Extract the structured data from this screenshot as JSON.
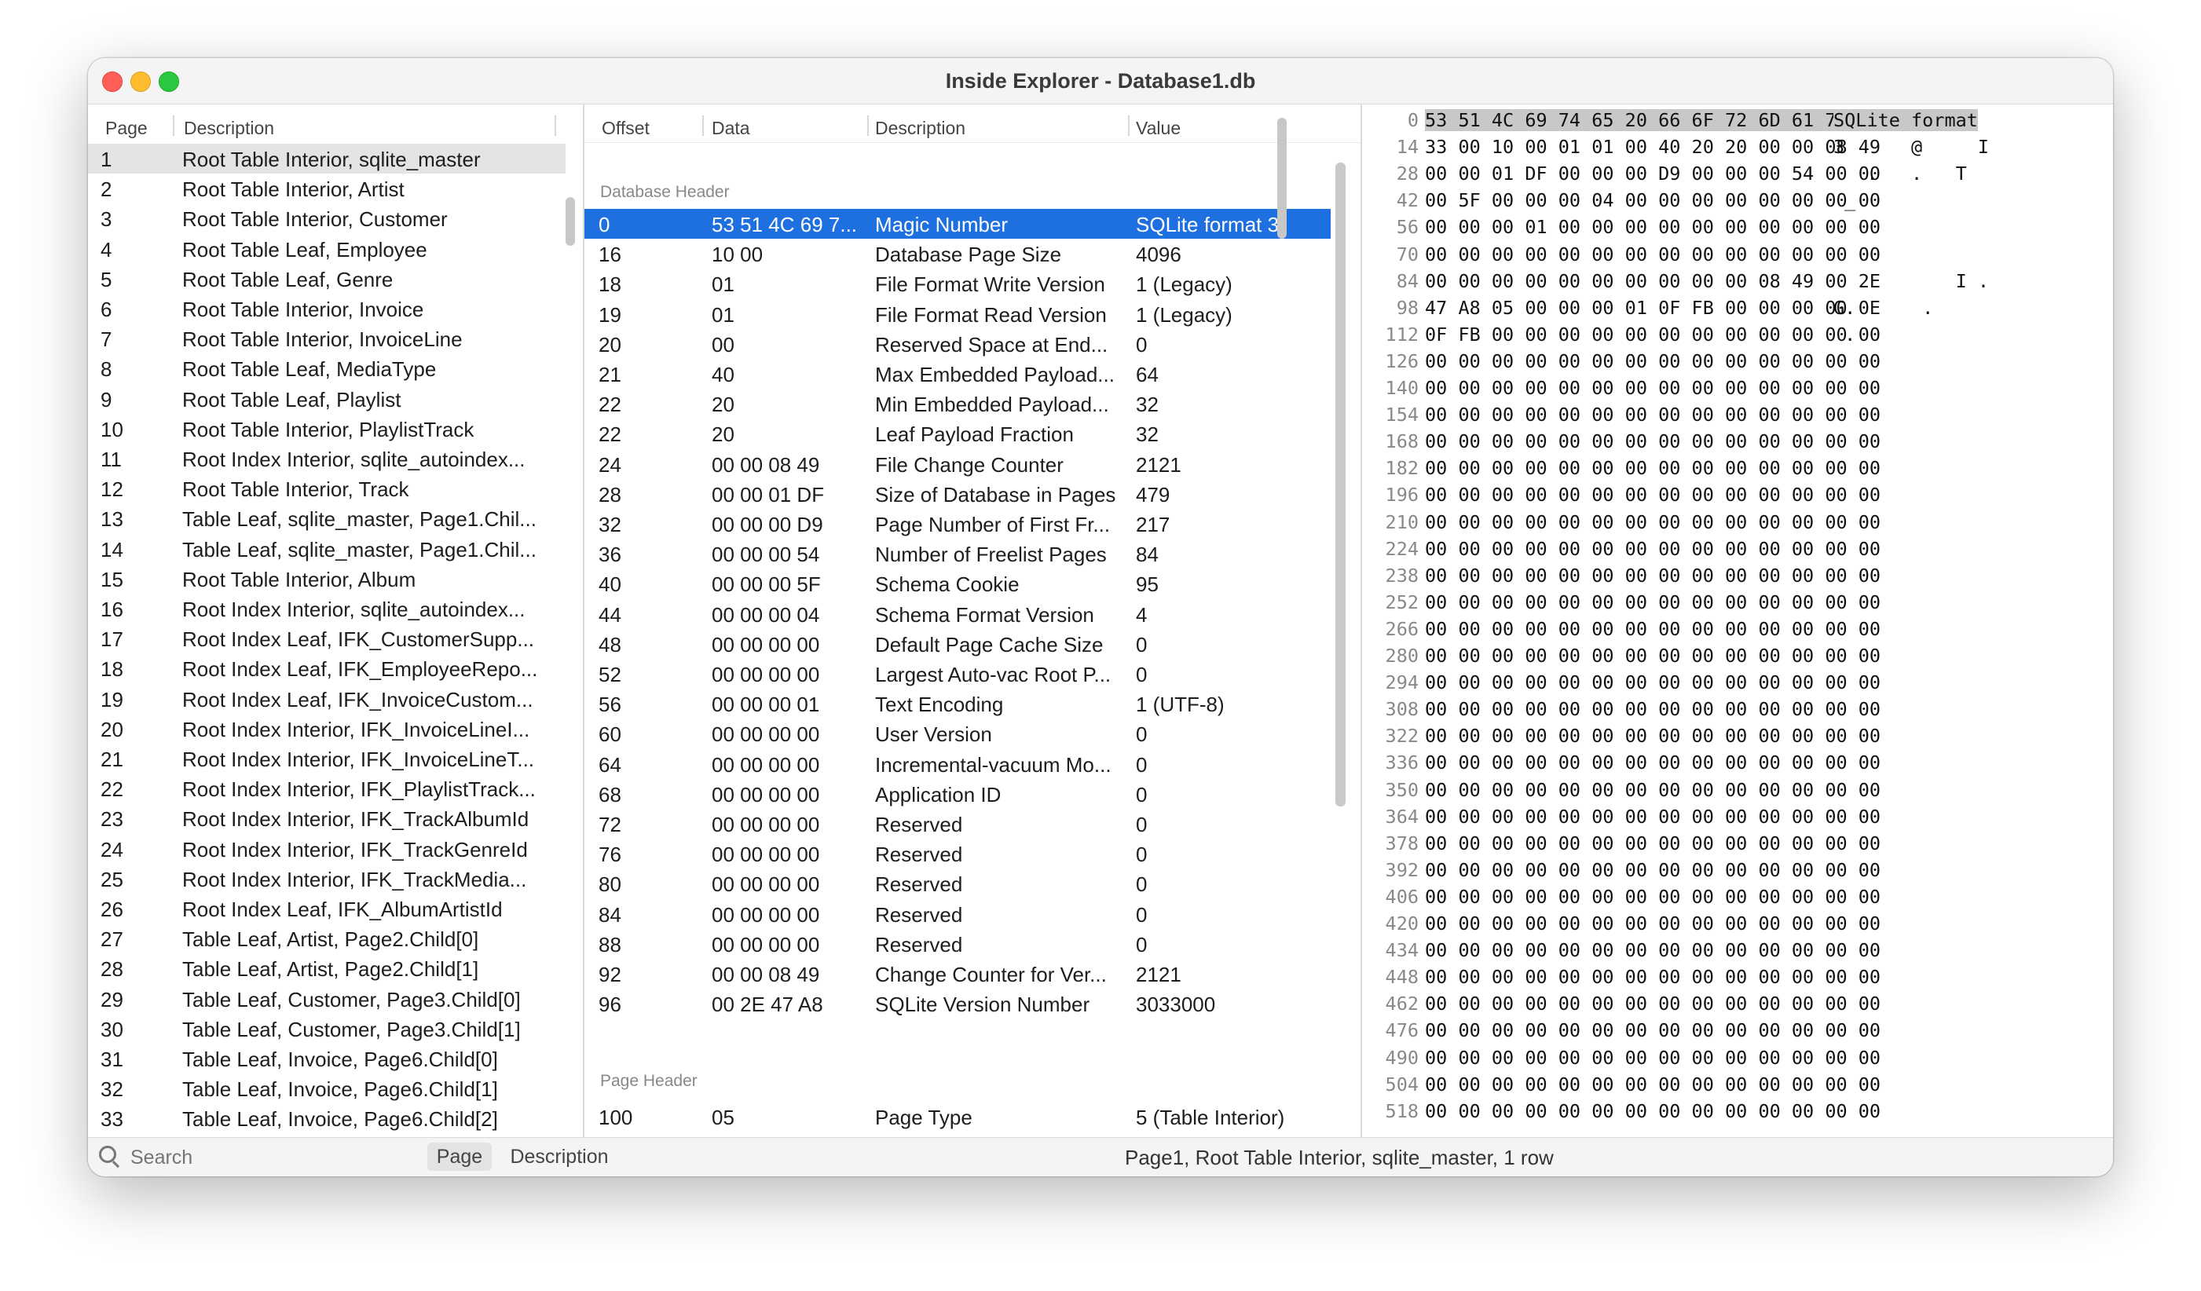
{
  "window": {
    "title": "Inside Explorer - Database1.db"
  },
  "pages_panel": {
    "columns": [
      "Page",
      "Description"
    ],
    "rows": [
      {
        "page": "1",
        "desc": "Root Table Interior, sqlite_master"
      },
      {
        "page": "2",
        "desc": "Root Table Interior, Artist"
      },
      {
        "page": "3",
        "desc": "Root Table Interior, Customer"
      },
      {
        "page": "4",
        "desc": "Root Table Leaf, Employee"
      },
      {
        "page": "5",
        "desc": "Root Table Leaf, Genre"
      },
      {
        "page": "6",
        "desc": "Root Table Interior, Invoice"
      },
      {
        "page": "7",
        "desc": "Root Table Interior, InvoiceLine"
      },
      {
        "page": "8",
        "desc": "Root Table Leaf, MediaType"
      },
      {
        "page": "9",
        "desc": "Root Table Leaf, Playlist"
      },
      {
        "page": "10",
        "desc": "Root Table Interior, PlaylistTrack"
      },
      {
        "page": "11",
        "desc": "Root Index Interior, sqlite_autoindex..."
      },
      {
        "page": "12",
        "desc": "Root Table Interior, Track"
      },
      {
        "page": "13",
        "desc": "Table Leaf, sqlite_master, Page1.Chil..."
      },
      {
        "page": "14",
        "desc": "Table Leaf, sqlite_master, Page1.Chil..."
      },
      {
        "page": "15",
        "desc": "Root Table Interior, Album"
      },
      {
        "page": "16",
        "desc": "Root Index Interior, sqlite_autoindex..."
      },
      {
        "page": "17",
        "desc": "Root Index Leaf, IFK_CustomerSupp..."
      },
      {
        "page": "18",
        "desc": "Root Index Leaf, IFK_EmployeeRepo..."
      },
      {
        "page": "19",
        "desc": "Root Index Leaf, IFK_InvoiceCustom..."
      },
      {
        "page": "20",
        "desc": "Root Index Interior, IFK_InvoiceLineI..."
      },
      {
        "page": "21",
        "desc": "Root Index Interior, IFK_InvoiceLineT..."
      },
      {
        "page": "22",
        "desc": "Root Index Interior, IFK_PlaylistTrack..."
      },
      {
        "page": "23",
        "desc": "Root Index Interior, IFK_TrackAlbumId"
      },
      {
        "page": "24",
        "desc": "Root Index Interior, IFK_TrackGenreId"
      },
      {
        "page": "25",
        "desc": "Root Index Interior, IFK_TrackMedia..."
      },
      {
        "page": "26",
        "desc": "Root Index Leaf, IFK_AlbumArtistId"
      },
      {
        "page": "27",
        "desc": "Table Leaf, Artist, Page2.Child[0]"
      },
      {
        "page": "28",
        "desc": "Table Leaf, Artist, Page2.Child[1]"
      },
      {
        "page": "29",
        "desc": "Table Leaf, Customer, Page3.Child[0]"
      },
      {
        "page": "30",
        "desc": "Table Leaf, Customer, Page3.Child[1]"
      },
      {
        "page": "31",
        "desc": "Table Leaf, Invoice, Page6.Child[0]"
      },
      {
        "page": "32",
        "desc": "Table Leaf, Invoice, Page6.Child[1]"
      },
      {
        "page": "33",
        "desc": "Table Leaf, Invoice, Page6.Child[2]"
      }
    ]
  },
  "fields_panel": {
    "columns": [
      "Offset",
      "Data",
      "Description",
      "Value"
    ],
    "section_db_header": "Database Header",
    "db_header": [
      {
        "offset": "0",
        "data": "53 51 4C 69 7...",
        "desc": "Magic Number",
        "value": "SQLite format 3"
      },
      {
        "offset": "16",
        "data": "10 00",
        "desc": "Database Page Size",
        "value": "4096"
      },
      {
        "offset": "18",
        "data": "01",
        "desc": "File Format Write Version",
        "value": "1 (Legacy)"
      },
      {
        "offset": "19",
        "data": "01",
        "desc": "File Format Read Version",
        "value": "1 (Legacy)"
      },
      {
        "offset": "20",
        "data": "00",
        "desc": "Reserved Space at End...",
        "value": "0"
      },
      {
        "offset": "21",
        "data": "40",
        "desc": "Max Embedded Payload...",
        "value": "64"
      },
      {
        "offset": "22",
        "data": "20",
        "desc": "Min Embedded Payload...",
        "value": "32"
      },
      {
        "offset": "22",
        "data": "20",
        "desc": "Leaf Payload Fraction",
        "value": "32"
      },
      {
        "offset": "24",
        "data": "00 00 08 49",
        "desc": "File Change Counter",
        "value": "2121"
      },
      {
        "offset": "28",
        "data": "00 00 01 DF",
        "desc": "Size of Database in Pages",
        "value": "479"
      },
      {
        "offset": "32",
        "data": "00 00 00 D9",
        "desc": "Page Number of First Fr...",
        "value": "217"
      },
      {
        "offset": "36",
        "data": "00 00 00 54",
        "desc": "Number of Freelist Pages",
        "value": "84"
      },
      {
        "offset": "40",
        "data": "00 00 00 5F",
        "desc": "Schema Cookie",
        "value": "95"
      },
      {
        "offset": "44",
        "data": "00 00 00 04",
        "desc": "Schema Format Version",
        "value": "4"
      },
      {
        "offset": "48",
        "data": "00 00 00 00",
        "desc": "Default Page Cache Size",
        "value": "0"
      },
      {
        "offset": "52",
        "data": "00 00 00 00",
        "desc": "Largest Auto-vac Root P...",
        "value": "0"
      },
      {
        "offset": "56",
        "data": "00 00 00 01",
        "desc": "Text Encoding",
        "value": "1 (UTF-8)"
      },
      {
        "offset": "60",
        "data": "00 00 00 00",
        "desc": "User Version",
        "value": "0"
      },
      {
        "offset": "64",
        "data": "00 00 00 00",
        "desc": "Incremental-vacuum Mo...",
        "value": "0"
      },
      {
        "offset": "68",
        "data": "00 00 00 00",
        "desc": "Application ID",
        "value": "0"
      },
      {
        "offset": "72",
        "data": "00 00 00 00",
        "desc": "Reserved",
        "value": "0"
      },
      {
        "offset": "76",
        "data": "00 00 00 00",
        "desc": "Reserved",
        "value": "0"
      },
      {
        "offset": "80",
        "data": "00 00 00 00",
        "desc": "Reserved",
        "value": "0"
      },
      {
        "offset": "84",
        "data": "00 00 00 00",
        "desc": "Reserved",
        "value": "0"
      },
      {
        "offset": "88",
        "data": "00 00 00 00",
        "desc": "Reserved",
        "value": "0"
      },
      {
        "offset": "92",
        "data": "00 00 08 49",
        "desc": "Change Counter for Ver...",
        "value": "2121"
      },
      {
        "offset": "96",
        "data": "00 2E 47 A8",
        "desc": "SQLite Version Number",
        "value": "3033000"
      }
    ],
    "section_page_header": "Page Header",
    "page_header": [
      {
        "offset": "100",
        "data": "05",
        "desc": "Page Type",
        "value": "5 (Table Interior)"
      }
    ]
  },
  "hex_panel": {
    "rows": [
      {
        "off": "0",
        "bytes": "53 51 4C 69 74 65 20 66 6F 72 6D 61 74 20",
        "ascii": "SQLite format"
      },
      {
        "off": "14",
        "bytes": "33 00 10 00 01 01 00 40 20 20 00 00 08 49",
        "ascii": "3      @     I"
      },
      {
        "off": "28",
        "bytes": "00 00 01 DF 00 00 00 D9 00 00 00 54 00 00",
        "ascii": "   .   .   T"
      },
      {
        "off": "42",
        "bytes": "00 5F 00 00 00 04 00 00 00 00 00 00 00 00",
        "ascii": " _"
      },
      {
        "off": "56",
        "bytes": "00 00 00 01 00 00 00 00 00 00 00 00 00 00",
        "ascii": ""
      },
      {
        "off": "70",
        "bytes": "00 00 00 00 00 00 00 00 00 00 00 00 00 00",
        "ascii": ""
      },
      {
        "off": "84",
        "bytes": "00 00 00 00 00 00 00 00 00 00 08 49 00 2E",
        "ascii": "           I ."
      },
      {
        "off": "98",
        "bytes": "47 A8 05 00 00 00 01 0F FB 00 00 00 00 0E",
        "ascii": "G.      ."
      },
      {
        "off": "112",
        "bytes": "0F FB 00 00 00 00 00 00 00 00 00 00 00 00",
        "ascii": " ."
      },
      {
        "off": "126",
        "bytes": "00 00 00 00 00 00 00 00 00 00 00 00 00 00",
        "ascii": ""
      },
      {
        "off": "140",
        "bytes": "00 00 00 00 00 00 00 00 00 00 00 00 00 00",
        "ascii": ""
      },
      {
        "off": "154",
        "bytes": "00 00 00 00 00 00 00 00 00 00 00 00 00 00",
        "ascii": ""
      },
      {
        "off": "168",
        "bytes": "00 00 00 00 00 00 00 00 00 00 00 00 00 00",
        "ascii": ""
      },
      {
        "off": "182",
        "bytes": "00 00 00 00 00 00 00 00 00 00 00 00 00 00",
        "ascii": ""
      },
      {
        "off": "196",
        "bytes": "00 00 00 00 00 00 00 00 00 00 00 00 00 00",
        "ascii": ""
      },
      {
        "off": "210",
        "bytes": "00 00 00 00 00 00 00 00 00 00 00 00 00 00",
        "ascii": ""
      },
      {
        "off": "224",
        "bytes": "00 00 00 00 00 00 00 00 00 00 00 00 00 00",
        "ascii": ""
      },
      {
        "off": "238",
        "bytes": "00 00 00 00 00 00 00 00 00 00 00 00 00 00",
        "ascii": ""
      },
      {
        "off": "252",
        "bytes": "00 00 00 00 00 00 00 00 00 00 00 00 00 00",
        "ascii": ""
      },
      {
        "off": "266",
        "bytes": "00 00 00 00 00 00 00 00 00 00 00 00 00 00",
        "ascii": ""
      },
      {
        "off": "280",
        "bytes": "00 00 00 00 00 00 00 00 00 00 00 00 00 00",
        "ascii": ""
      },
      {
        "off": "294",
        "bytes": "00 00 00 00 00 00 00 00 00 00 00 00 00 00",
        "ascii": ""
      },
      {
        "off": "308",
        "bytes": "00 00 00 00 00 00 00 00 00 00 00 00 00 00",
        "ascii": ""
      },
      {
        "off": "322",
        "bytes": "00 00 00 00 00 00 00 00 00 00 00 00 00 00",
        "ascii": ""
      },
      {
        "off": "336",
        "bytes": "00 00 00 00 00 00 00 00 00 00 00 00 00 00",
        "ascii": ""
      },
      {
        "off": "350",
        "bytes": "00 00 00 00 00 00 00 00 00 00 00 00 00 00",
        "ascii": ""
      },
      {
        "off": "364",
        "bytes": "00 00 00 00 00 00 00 00 00 00 00 00 00 00",
        "ascii": ""
      },
      {
        "off": "378",
        "bytes": "00 00 00 00 00 00 00 00 00 00 00 00 00 00",
        "ascii": ""
      },
      {
        "off": "392",
        "bytes": "00 00 00 00 00 00 00 00 00 00 00 00 00 00",
        "ascii": ""
      },
      {
        "off": "406",
        "bytes": "00 00 00 00 00 00 00 00 00 00 00 00 00 00",
        "ascii": ""
      },
      {
        "off": "420",
        "bytes": "00 00 00 00 00 00 00 00 00 00 00 00 00 00",
        "ascii": ""
      },
      {
        "off": "434",
        "bytes": "00 00 00 00 00 00 00 00 00 00 00 00 00 00",
        "ascii": ""
      },
      {
        "off": "448",
        "bytes": "00 00 00 00 00 00 00 00 00 00 00 00 00 00",
        "ascii": ""
      },
      {
        "off": "462",
        "bytes": "00 00 00 00 00 00 00 00 00 00 00 00 00 00",
        "ascii": ""
      },
      {
        "off": "476",
        "bytes": "00 00 00 00 00 00 00 00 00 00 00 00 00 00",
        "ascii": ""
      },
      {
        "off": "490",
        "bytes": "00 00 00 00 00 00 00 00 00 00 00 00 00 00",
        "ascii": ""
      },
      {
        "off": "504",
        "bytes": "00 00 00 00 00 00 00 00 00 00 00 00 00 00",
        "ascii": ""
      },
      {
        "off": "518",
        "bytes": "00 00 00 00 00 00 00 00 00 00 00 00 00 00",
        "ascii": ""
      }
    ]
  },
  "statusbar": {
    "search_placeholder": "Search",
    "scope_page": "Page",
    "scope_description": "Description",
    "status": "Page1, Root Table Interior, sqlite_master, 1 row"
  },
  "colors": {
    "selection": "#1e6fe0",
    "row_highlight": "#e4e4e4",
    "hex_highlight": "#c8c8c8"
  }
}
